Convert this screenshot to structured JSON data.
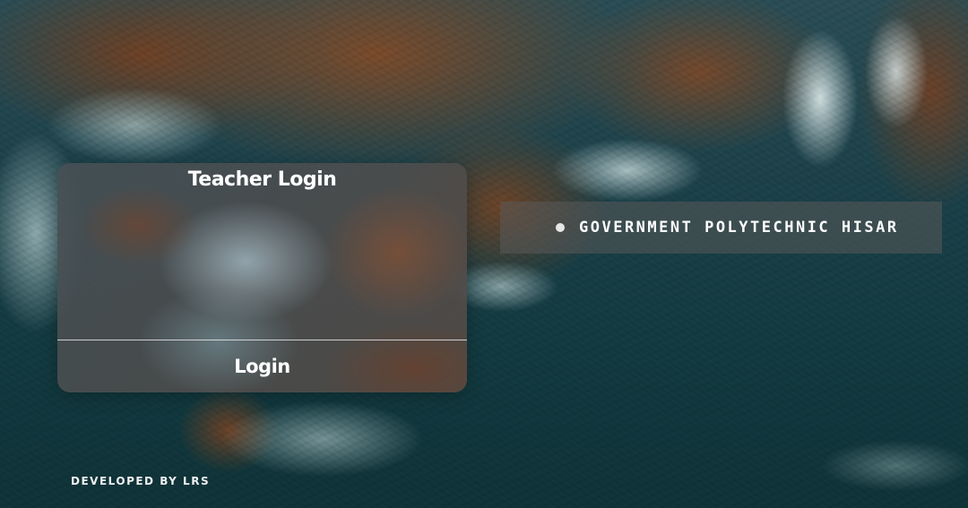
{
  "login_card": {
    "title": "Teacher Login",
    "login_label": "Login"
  },
  "banner": {
    "college_name": "GOVERNMENT POLYTECHNIC HISAR",
    "bullet_icon": "circle-bullet-icon"
  },
  "footer": {
    "credit": "DEVELOPED BY LRS"
  },
  "colors": {
    "text": "#ffffff",
    "ocean": "#123a40",
    "rock": "#7a4a2a"
  }
}
